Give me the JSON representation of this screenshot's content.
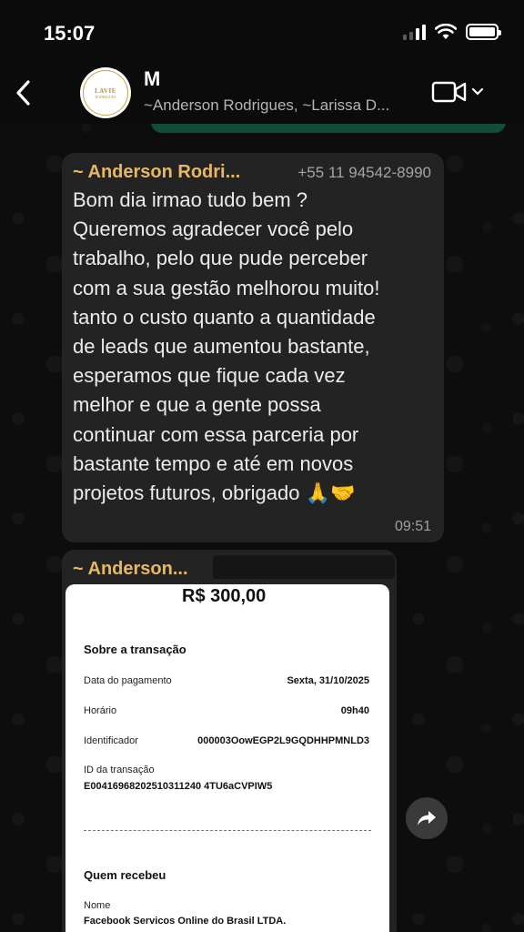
{
  "status": {
    "time": "15:07"
  },
  "header": {
    "title": "M",
    "subtitle": "~Anderson Rodrigues, ~Larissa D...",
    "avatar": {
      "logo_text": "LAVIE",
      "logo_sub": "RODRIGUES"
    }
  },
  "messages": [
    {
      "sender": "~ Anderson Rodri...",
      "phone": "+55 11 94542-8990",
      "text": "Bom dia irmao tudo bem ?\nQueremos agradecer você pelo\ntrabalho, pelo que pude perceber\ncom a sua gestão melhorou muito!\ntanto o custo quanto a quantidade\nde leads que aumentou bastante,\nesperamos que fique cada vez\nmelhor e que a gente possa\ncontinuar com essa parceria por\nbastante tempo e até em novos\nprojetos futuros, obrigado",
      "emojis": "🙏🤝",
      "time": "09:51"
    },
    {
      "sender": "~ Anderson...",
      "receipt": {
        "amount": "R$ 300,00",
        "section_transaction": "Sobre a transação",
        "payment_date_label": "Data do pagamento",
        "payment_date_value": "Sexta, 31/10/2025",
        "time_label": "Horário",
        "time_value": "09h40",
        "identifier_label": "Identificador",
        "identifier_value": "000003OowEGP2L9GQDHHPMNLD3",
        "transaction_id_label": "ID da transação",
        "transaction_id_value": "E00416968202510311240 4TU6aCVPIW5",
        "section_receiver": "Quem recebeu",
        "name_label": "Nome",
        "name_value": "Facebook Servicos Online do Brasil LTDA."
      }
    }
  ],
  "colors": {
    "sender_name": "#e8b764",
    "incoming_bubble": "#232323",
    "outgoing_bubble": "#144d37"
  }
}
